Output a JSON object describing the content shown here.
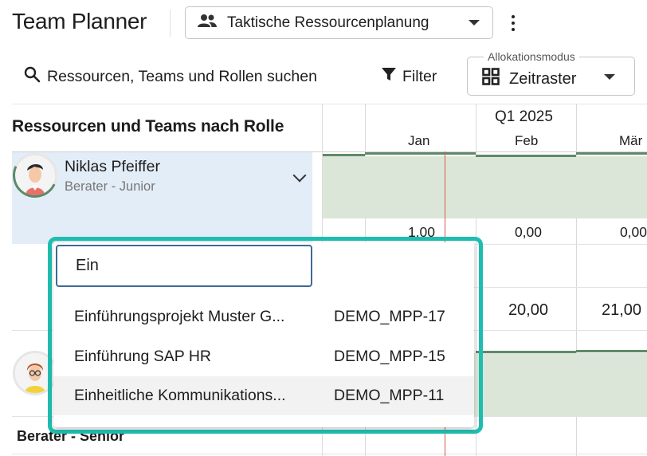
{
  "header": {
    "title": "Team Planner",
    "plan_select": "Taktische Ressourcenplanung",
    "more_icon": "more-vert-icon"
  },
  "toolbar": {
    "search_label": "Ressourcen, Teams und Rollen suchen",
    "filter_label": "Filter",
    "mode_legend": "Allokationsmodus",
    "mode_value": "Zeitraster"
  },
  "grid": {
    "left_header": "Ressourcen und Teams nach Rolle",
    "quarter": "Q1 2025",
    "months": [
      "Jan",
      "Feb",
      "Mär"
    ]
  },
  "resource": {
    "name": "Niklas Pfeiffer",
    "role": "Berater - Junior"
  },
  "values_row1": [
    "1,00",
    "0,00",
    "0,00"
  ],
  "values_row2": [
    "20,00",
    "21,00"
  ],
  "section": {
    "label": "Berater - Senior"
  },
  "popup": {
    "search_value": "Ein",
    "items": [
      {
        "name": "Einführungsprojekt Muster G...",
        "code": "DEMO_MPP-17"
      },
      {
        "name": "Einführung SAP HR",
        "code": "DEMO_MPP-15"
      },
      {
        "name": "Einheitliche Kommunikations...",
        "code": "DEMO_MPP-11"
      }
    ]
  },
  "colors": {
    "highlight": "#1fbdb0",
    "allocation": "#dbe6d8",
    "allocation_line": "#5e8a68",
    "today_line": "#d9574a",
    "row_selected": "#e3edf7"
  }
}
